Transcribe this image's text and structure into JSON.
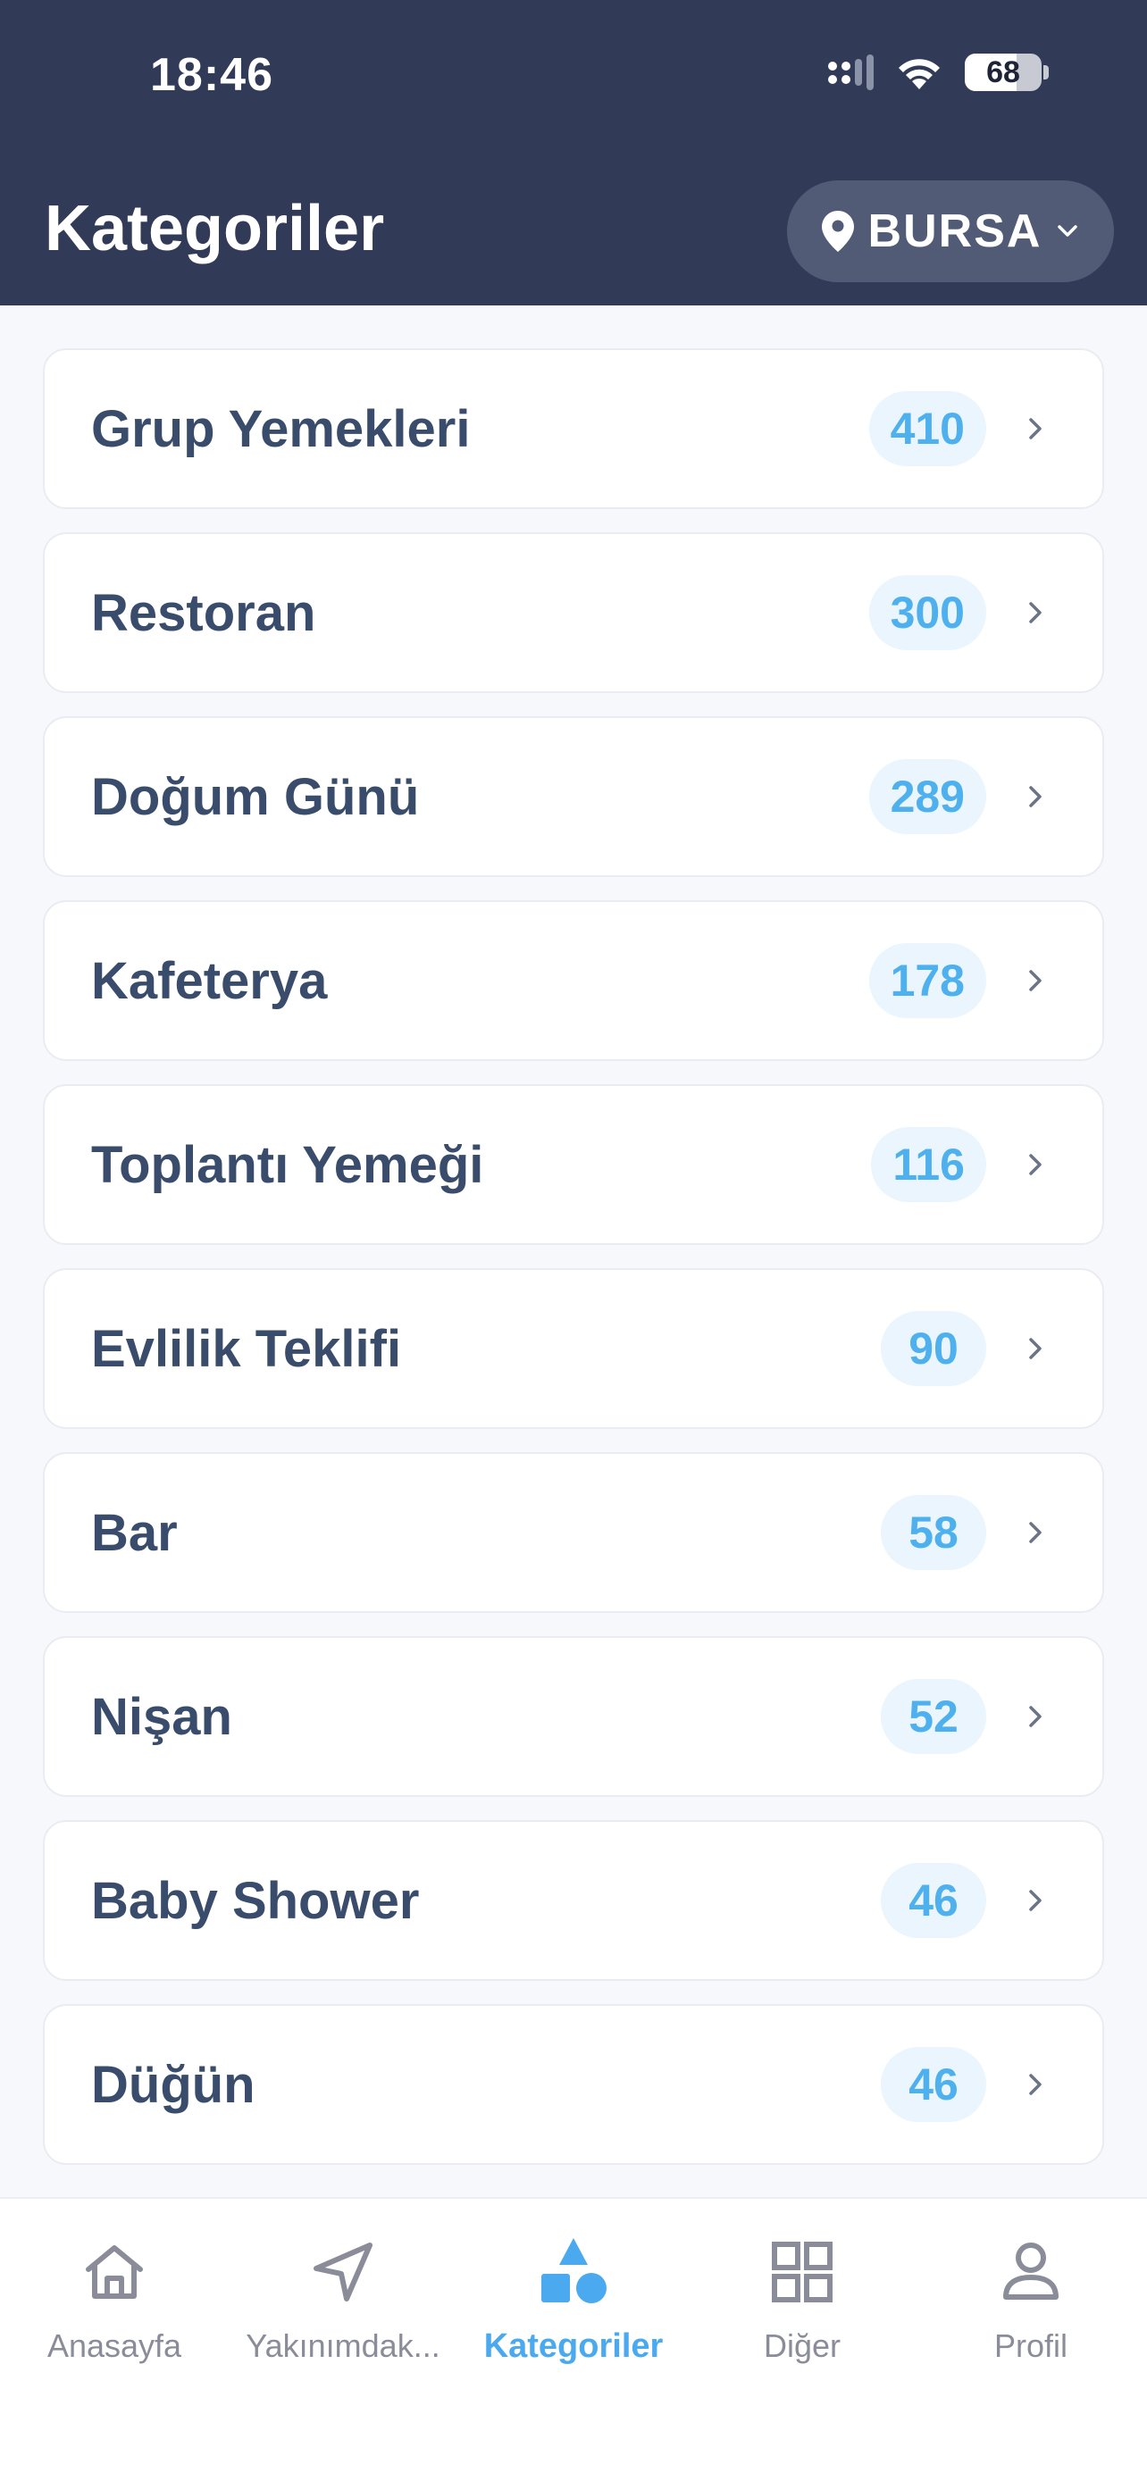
{
  "status_bar": {
    "time": "18:46",
    "battery": "68"
  },
  "header": {
    "title": "Kategoriler",
    "city": "BURSA"
  },
  "categories": [
    {
      "label": "Grup Yemekleri",
      "count": "410"
    },
    {
      "label": "Restoran",
      "count": "300"
    },
    {
      "label": "Doğum Günü",
      "count": "289"
    },
    {
      "label": "Kafeterya",
      "count": "178"
    },
    {
      "label": "Toplantı Yemeği",
      "count": "116"
    },
    {
      "label": "Evlilik Teklifi",
      "count": "90"
    },
    {
      "label": "Bar",
      "count": "58"
    },
    {
      "label": "Nişan",
      "count": "52"
    },
    {
      "label": "Baby Shower",
      "count": "46"
    },
    {
      "label": "Düğün",
      "count": "46"
    }
  ],
  "tabbar": {
    "items": [
      {
        "label": "Anasayfa",
        "icon": "home-icon"
      },
      {
        "label": "Yakınımdak...",
        "icon": "navigation-arrow-icon"
      },
      {
        "label": "Kategoriler",
        "icon": "shapes-icon",
        "active": true
      },
      {
        "label": "Diğer",
        "icon": "grid-icon"
      },
      {
        "label": "Profil",
        "icon": "user-icon"
      }
    ]
  },
  "colors": {
    "header_bg": "#313b58",
    "accent": "#4aa9ef",
    "badge_bg": "#eaf5fd",
    "text_primary": "#3a4c6b"
  }
}
